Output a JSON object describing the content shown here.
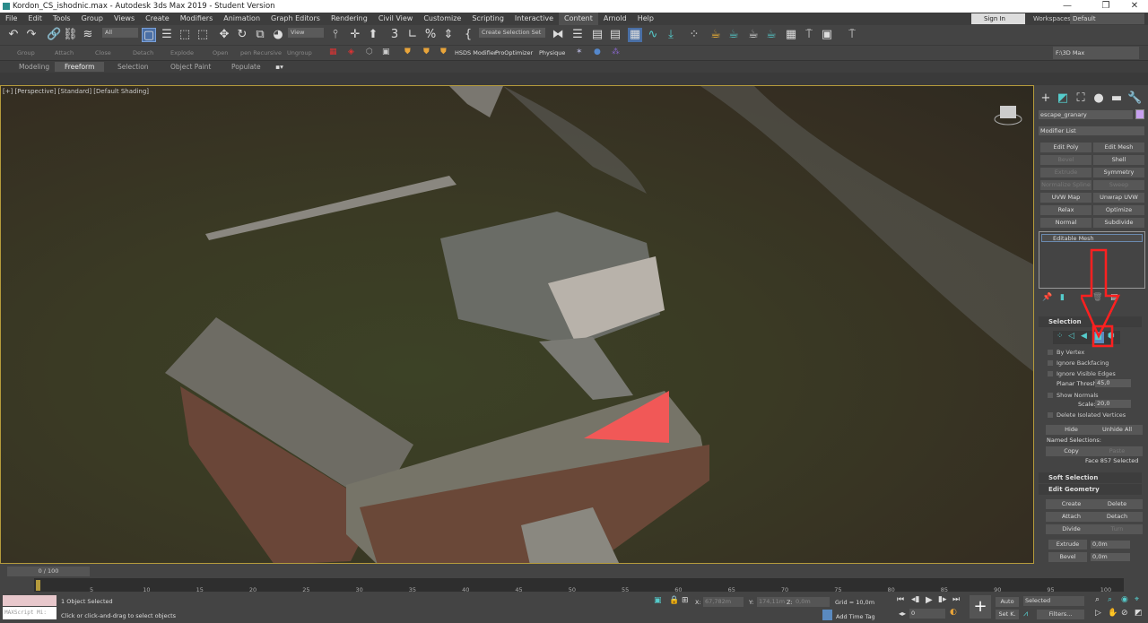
{
  "window": {
    "title": "Kordon_CS_ishodnic.max - Autodesk 3ds Max 2019 - Student Version",
    "min": "—",
    "max": "❐",
    "close": "✕"
  },
  "menu": [
    "File",
    "Edit",
    "Tools",
    "Group",
    "Views",
    "Create",
    "Modifiers",
    "Animation",
    "Graph Editors",
    "Rendering",
    "Civil View",
    "Customize",
    "Scripting",
    "Interactive",
    "Content",
    "Arnold",
    "Help"
  ],
  "menu_active": "Content",
  "signin": "Sign In",
  "workspaces": {
    "label": "Workspaces:",
    "value": "Default"
  },
  "toolbar": {
    "filter": "All",
    "ref_coord": "View",
    "selection_set": "Create Selection Set",
    "project_path": "F:\\3D Max"
  },
  "toolbar2": {
    "disabled": [
      "Group",
      "Attach",
      "Close",
      "Detach",
      "Explode",
      "Open",
      "pen Recursive",
      "Ungroup"
    ],
    "plugins": [
      "HSDS Modifier",
      "ProOptimizer",
      "Physique"
    ]
  },
  "ribbon": {
    "tabs": [
      "Modeling",
      "Freeform",
      "Selection",
      "Object Paint",
      "Populate"
    ],
    "active": "Freeform"
  },
  "viewport": {
    "label": "[+] [Perspective] [Standard] [Default Shading]",
    "selection_color": "#ff5555"
  },
  "command_panel": {
    "object_name": "escape_granary",
    "object_color": "#c8a0f0",
    "modifier_list": "Modifier List",
    "modifier_buttons": [
      [
        "Edit Poly",
        true
      ],
      [
        "Edit Mesh",
        true
      ],
      [
        "Bevel",
        false
      ],
      [
        "Shell",
        true
      ],
      [
        "Extrude",
        false
      ],
      [
        "Symmetry",
        true
      ],
      [
        "Normalize Spline",
        false
      ],
      [
        "Sweep",
        false
      ],
      [
        "UVW Map",
        true
      ],
      [
        "Unwrap UVW",
        true
      ],
      [
        "Relax",
        true
      ],
      [
        "Optimize",
        true
      ],
      [
        "Normal",
        true
      ],
      [
        "Subdivide",
        true
      ]
    ],
    "stack_item": "Editable Mesh",
    "selection": {
      "title": "Selection",
      "active_level": "face",
      "by_vertex": "By Vertex",
      "ignore_backfacing": "Ignore Backfacing",
      "ignore_visible_edges": "Ignore Visible Edges",
      "planar_thresh_label": "Planar Thresh:",
      "planar_thresh": "45,0",
      "show_normals": "Show Normals",
      "scale_label": "Scale:",
      "scale": "20,0",
      "delete_isolated": "Delete Isolated Vertices",
      "delete_isolated_checked": true,
      "hide": "Hide",
      "unhide_all": "Unhide All",
      "named_selections": "Named Selections:",
      "copy": "Copy",
      "paste": "Paste",
      "status": "Face 857 Selected"
    },
    "soft_selection": "Soft Selection",
    "edit_geometry": {
      "title": "Edit Geometry",
      "create": "Create",
      "delete": "Delete",
      "attach": "Attach",
      "detach": "Detach",
      "divide": "Divide",
      "turn": "Turn",
      "extrude": "Extrude",
      "extrude_val": "0,0m",
      "bevel": "Bevel",
      "bevel_val": "0,0m"
    }
  },
  "annotation_color": "#ff2020",
  "timeline": {
    "frame": "0 / 100",
    "ticks": [
      "0",
      "5",
      "10",
      "15",
      "20",
      "25",
      "30",
      "35",
      "40",
      "45",
      "50",
      "55",
      "60",
      "65",
      "70",
      "75",
      "80",
      "85",
      "90",
      "95",
      "100"
    ]
  },
  "status": {
    "maxscript": "MAXScript Mi:",
    "objects": "1 Object Selected",
    "prompt": "Click or click-and-drag to select objects",
    "x_label": "X:",
    "x": "67,782m",
    "y_label": "Y:",
    "y": "174,11m",
    "z_label": "Z:",
    "z": "0,0m",
    "grid": "Grid = 10,0m",
    "add_time_tag": "Add Time Tag",
    "current_frame": "0",
    "auto": "Auto",
    "set_key": "Set K.",
    "key_mode": "Selected",
    "filters": "Filters..."
  }
}
